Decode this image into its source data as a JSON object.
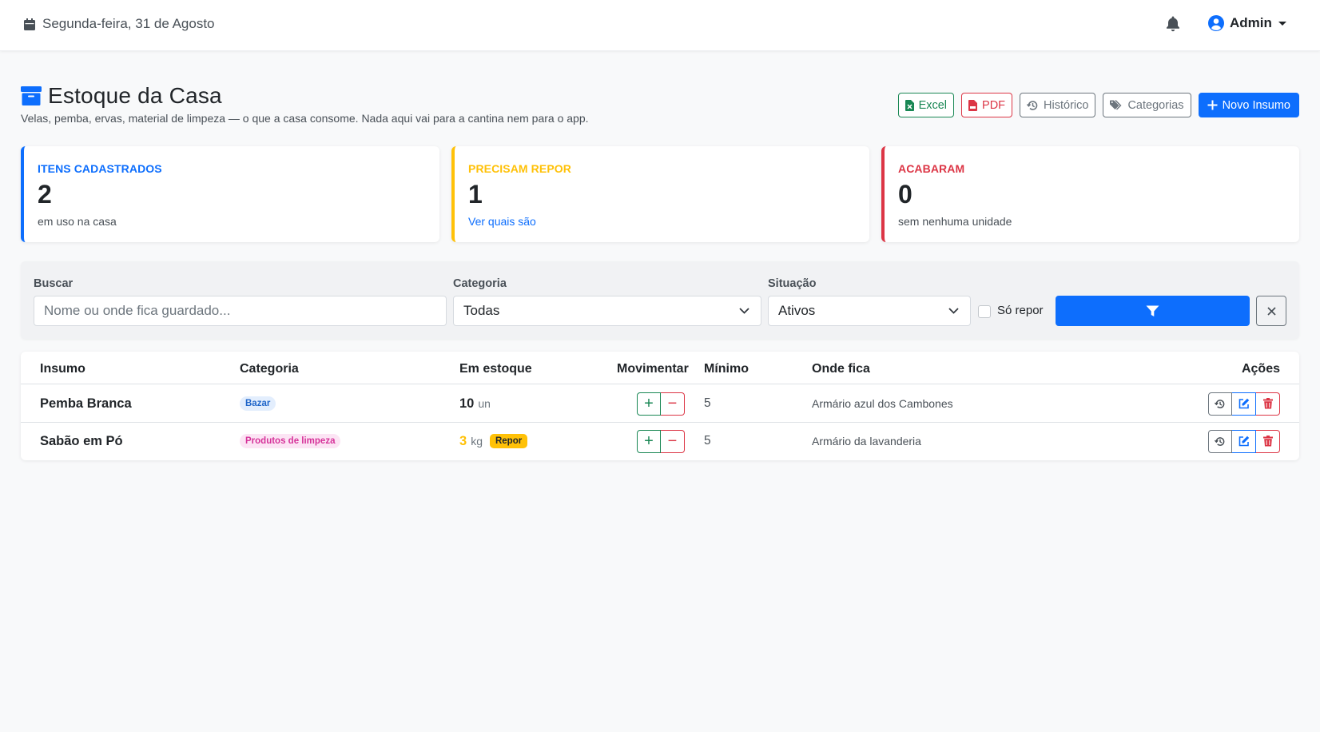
{
  "topbar": {
    "date": "Segunda-feira, 31 de Agosto",
    "user": "Admin"
  },
  "page": {
    "title": "Estoque da Casa",
    "subtitle": "Velas, pemba, ervas, material de limpeza — o que a casa consome. Nada aqui vai para a cantina nem para o app."
  },
  "actions": {
    "excel": "Excel",
    "pdf": "PDF",
    "historico": "Histórico",
    "categorias": "Categorias",
    "novo": "Novo Insumo"
  },
  "cards": [
    {
      "label": "ITENS CADASTRADOS",
      "value": "2",
      "sub": "em uso na casa"
    },
    {
      "label": "PRECISAM REPOR",
      "value": "1",
      "sub": "Ver quais são"
    },
    {
      "label": "ACABARAM",
      "value": "0",
      "sub": "sem nenhuma unidade"
    }
  ],
  "filters": {
    "search_label": "Buscar",
    "search_placeholder": "Nome ou onde fica guardado...",
    "category_label": "Categoria",
    "category_value": "Todas",
    "status_label": "Situação",
    "status_value": "Ativos",
    "only_restock_label": "Só repor"
  },
  "table": {
    "headers": {
      "insumo": "Insumo",
      "categoria": "Categoria",
      "estoque": "Em estoque",
      "movimentar": "Movimentar",
      "minimo": "Mínimo",
      "onde": "Onde fica",
      "acoes": "Ações"
    },
    "rows": [
      {
        "name": "Pemba Branca",
        "category": "Bazar",
        "qty": "10",
        "unit": "un",
        "min": "5",
        "location": "Armário azul dos Cambones",
        "flag": ""
      },
      {
        "name": "Sabão em Pó",
        "category": "Produtos de limpeza",
        "qty": "3",
        "unit": "kg",
        "min": "5",
        "location": "Armário da lavanderia",
        "flag": "Repor"
      }
    ]
  },
  "colors": {
    "primary": "#0d6efd",
    "success": "#198754",
    "danger": "#dc3545",
    "warning": "#ffc107"
  }
}
